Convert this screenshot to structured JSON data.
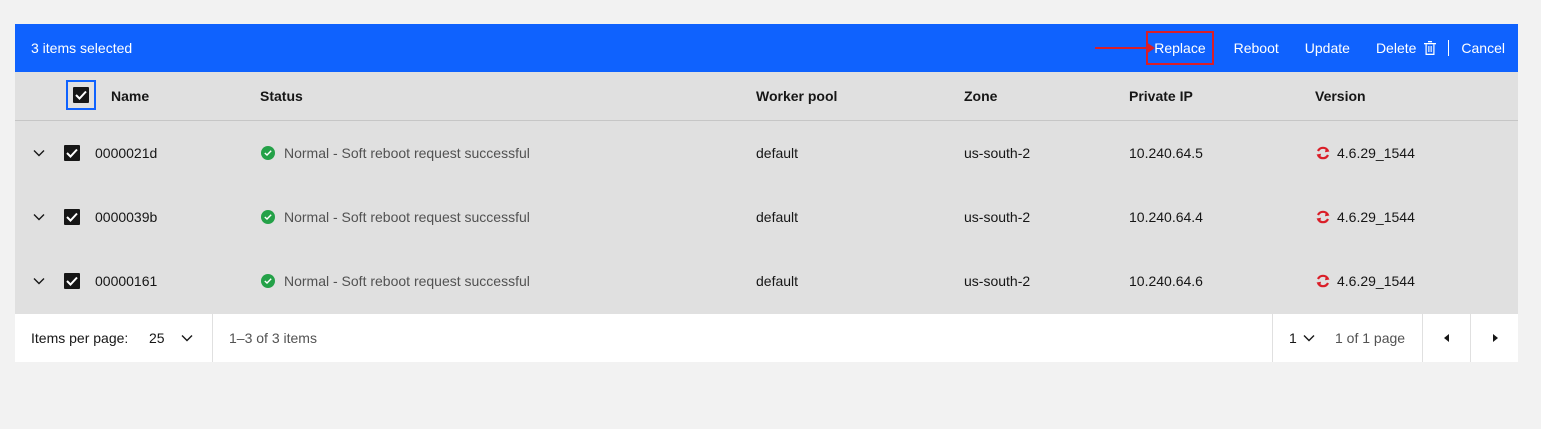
{
  "batch_bar": {
    "selected_text": "3 items selected",
    "actions": [
      "Replace",
      "Reboot",
      "Update",
      "Delete",
      "Cancel"
    ],
    "accent_color": "#0f62fe",
    "highlight_color": "#da1e28"
  },
  "table": {
    "columns": [
      "Name",
      "Status",
      "Worker pool",
      "Zone",
      "Private IP",
      "Version"
    ],
    "rows": [
      {
        "name": "0000021d",
        "status": "Normal - Soft reboot request successful",
        "worker_pool": "default",
        "zone": "us-south-2",
        "private_ip": "10.240.64.5",
        "version": "4.6.29_1544"
      },
      {
        "name": "0000039b",
        "status": "Normal - Soft reboot request successful",
        "worker_pool": "default",
        "zone": "us-south-2",
        "private_ip": "10.240.64.4",
        "version": "4.6.29_1544"
      },
      {
        "name": "00000161",
        "status": "Normal - Soft reboot request successful",
        "worker_pool": "default",
        "zone": "us-south-2",
        "private_ip": "10.240.64.6",
        "version": "4.6.29_1544"
      }
    ],
    "status_color": "#24a148",
    "version_icon": "openshift-refresh-icon",
    "version_icon_color": "#da1e28"
  },
  "pagination": {
    "items_per_page_label": "Items per page:",
    "items_per_page_value": "25",
    "range_text": "1–3 of 3 items",
    "page_value": "1",
    "page_total_text": "1 of 1 page"
  }
}
